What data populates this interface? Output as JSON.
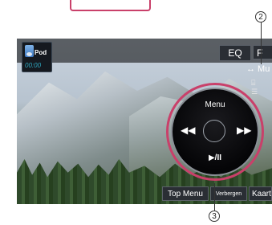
{
  "screen": {
    "source_badge": {
      "label": "Pod",
      "time": "00:00"
    },
    "top_buttons": {
      "eq": "EQ",
      "function": "F"
    },
    "menu_item": {
      "label": "↔ Mu"
    },
    "side_icons": "⌸ ☰",
    "control": {
      "menu": "Menu",
      "prev": "◀◀",
      "next": "▶▶",
      "play_pause": "▶/II"
    },
    "bottom_buttons": {
      "top_menu": "Top Menu",
      "hide": "Verbergen",
      "map": "Kaart"
    }
  },
  "callouts": {
    "c2": "2",
    "c3": "3"
  },
  "colors": {
    "highlight": "#c9406a",
    "accent_cyan": "#2fa8c0"
  }
}
